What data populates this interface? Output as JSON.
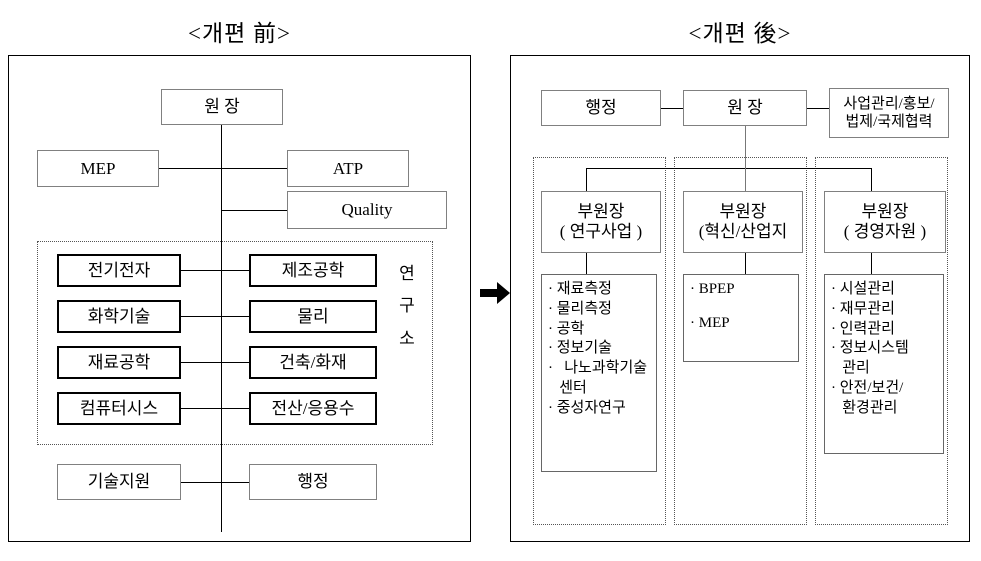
{
  "before": {
    "title": "<개편 前>",
    "director": "원 장",
    "mep": "MEP",
    "atp": "ATP",
    "quality": "Quality",
    "research_label_chars": [
      "연",
      "구",
      "소"
    ],
    "research_left": [
      "전기전자",
      "화학기술",
      "재료공학",
      "컴퓨터시스"
    ],
    "research_right": [
      "제조공학",
      "물리",
      "건축/화재",
      "전산/응용수"
    ],
    "tech_support": "기술지원",
    "admin": "행정"
  },
  "after": {
    "title": "<개편 後>",
    "director": "원 장",
    "admin": "행정",
    "staff_office": "사업관리/홍보/\n법제/국제협력",
    "columns": [
      {
        "head_line1": "부원장",
        "head_line2": "( 연구사업 )",
        "items": [
          "· 재료측정",
          "· 물리측정",
          "· 공학",
          "· 정보기술",
          "·   나노과학기술",
          "   센터",
          "· 중성자연구"
        ]
      },
      {
        "head_line1": "부원장",
        "head_line2": "(혁신/산업지",
        "items": [
          "· BPEP",
          "· MEP"
        ]
      },
      {
        "head_line1": "부원장",
        "head_line2": "( 경영자원 )",
        "items": [
          "· 시설관리",
          "· 재무관리",
          "· 인력관리",
          "· 정보시스템",
          "   관리",
          "· 안전/보건/",
          "   환경관리"
        ]
      }
    ]
  },
  "arrow": {
    "name": "transition-arrow",
    "color": "#000000"
  }
}
